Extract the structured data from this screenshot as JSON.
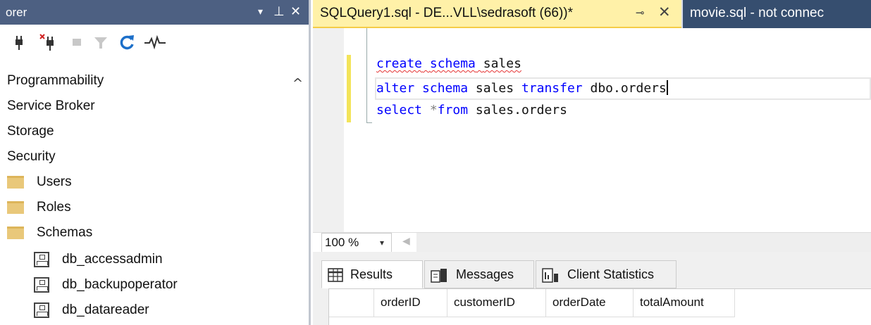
{
  "explorer": {
    "title": "orer",
    "dock_icon": "▾",
    "pin_icon": "⊥",
    "close_icon": "✕",
    "toolbar_icons": [
      "connect-icon",
      "disconnect-icon",
      "stop-icon",
      "filter-icon",
      "refresh-icon",
      "activity-monitor-icon"
    ],
    "tree": [
      {
        "label": "Programmability",
        "level": 0,
        "icon": "none"
      },
      {
        "label": "Service Broker",
        "level": 0,
        "icon": "none"
      },
      {
        "label": "Storage",
        "level": 0,
        "icon": "none"
      },
      {
        "label": "Security",
        "level": 0,
        "icon": "none"
      },
      {
        "label": "Users",
        "level": 1,
        "icon": "folder-icon"
      },
      {
        "label": "Roles",
        "level": 1,
        "icon": "folder-icon"
      },
      {
        "label": "Schemas",
        "level": 1,
        "icon": "folder-icon"
      },
      {
        "label": "db_accessadmin",
        "level": 2,
        "icon": "schema-icon"
      },
      {
        "label": "db_backupoperator",
        "level": 2,
        "icon": "schema-icon"
      },
      {
        "label": "db_datareader",
        "level": 2,
        "icon": "schema-icon"
      }
    ]
  },
  "tabs": {
    "active": {
      "label": "SQLQuery1.sql - DE...VLL\\sedrasoft (66))*",
      "pin": "⊸",
      "close": "✕"
    },
    "inactive": {
      "label": "movie.sql - not connec"
    }
  },
  "editor": {
    "line1": {
      "kw1": "create",
      "kw2": "schema",
      "id": "sales"
    },
    "line2": {
      "kw1": "alter",
      "kw2": "schema",
      "id1": "sales",
      "kw3": "transfer",
      "id2": "dbo.orders"
    },
    "line3": {
      "kw1": "select",
      "op": "*",
      "kw2": "from",
      "id": "sales.orders"
    }
  },
  "zoom": {
    "value": "100 %",
    "arrow": "▾",
    "scroll_left": "◀"
  },
  "results": {
    "tabs": [
      {
        "label": "Results",
        "icon": "grid-icon",
        "selected": true
      },
      {
        "label": "Messages",
        "icon": "messages-icon",
        "selected": false
      },
      {
        "label": "Client Statistics",
        "icon": "statistics-icon",
        "selected": false
      }
    ],
    "columns": [
      "orderID",
      "customerID",
      "orderDate",
      "totalAmount"
    ]
  },
  "colors": {
    "explorer_title_bg": "#4d6082",
    "active_tab_bg": "#fff1a8",
    "inactive_tab_bg": "#364e6f",
    "keyword": "#0000ff",
    "squiggle": "#e53333"
  }
}
